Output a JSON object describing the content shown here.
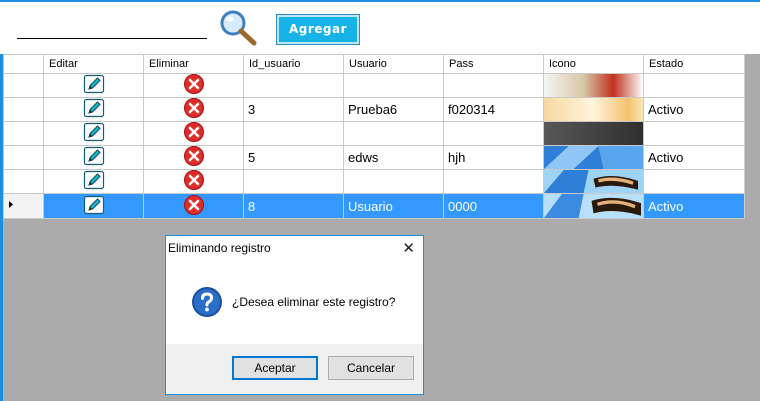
{
  "toolbar": {
    "search_value": "",
    "add_label": "Agregar",
    "accent": "#1e8fe0"
  },
  "grid": {
    "columns": [
      "Editar",
      "Eliminar",
      "Id_usuario",
      "Usuario",
      "Pass",
      "Icono",
      "Estado"
    ],
    "rows": [
      {
        "id": "",
        "usuario": "",
        "pass": "",
        "estado": ""
      },
      {
        "id": "3",
        "usuario": "Prueba6",
        "pass": "f020314",
        "estado": "Activo"
      },
      {
        "id": "",
        "usuario": "",
        "pass": "",
        "estado": ""
      },
      {
        "id": "5",
        "usuario": "edws",
        "pass": "hjh",
        "estado": "Activo"
      },
      {
        "id": "",
        "usuario": "",
        "pass": "",
        "estado": ""
      },
      {
        "id": "8",
        "usuario": "Usuario",
        "pass": "0000",
        "estado": "Activo",
        "selected": true
      }
    ],
    "selection_color": "#3399ff"
  },
  "dialog": {
    "title": "Eliminando registro",
    "close_glyph": "✕",
    "message": "¿Desea eliminar este registro?",
    "ok_label": "Aceptar",
    "cancel_label": "Cancelar"
  }
}
